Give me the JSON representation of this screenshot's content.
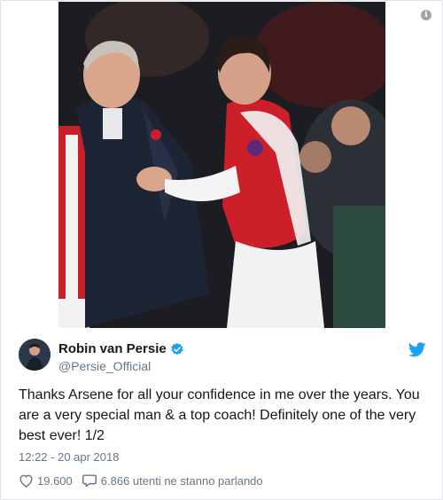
{
  "tweet": {
    "author_name": "Robin van Persie",
    "handle": "@Persie_Official",
    "text": "Thanks Arsene for all your confidence in me over the years. You are a very special man & a top coach! Definitely one of the very best ever! 1/2",
    "timestamp": "12:22 - 20 apr 2018",
    "likes": "19.600",
    "replies_label": "6.866 utenti ne stanno parlando"
  },
  "icons": {
    "info": "info-icon",
    "verified": "verified-badge-icon",
    "twitter": "twitter-bird-icon",
    "like": "heart-icon",
    "reply": "speech-bubble-icon"
  },
  "colors": {
    "twitter_blue": "#1da1f2",
    "text": "#14171a",
    "muted": "#657786"
  }
}
